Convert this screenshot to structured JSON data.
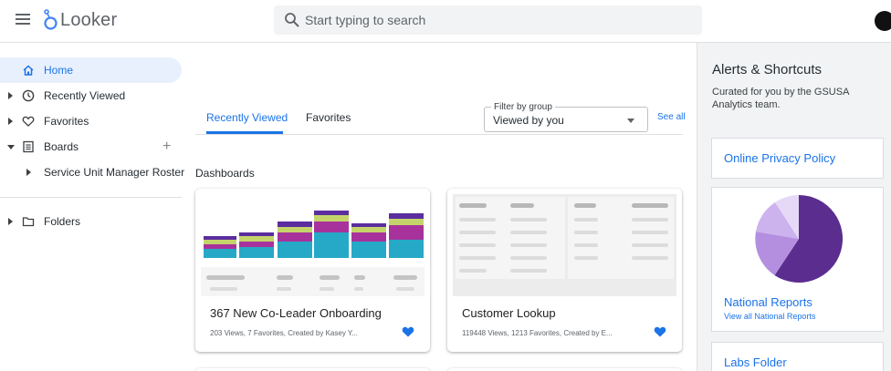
{
  "header": {
    "app_name": "Looker",
    "search_placeholder": "Start typing to search"
  },
  "sidebar": {
    "items": [
      {
        "label": "Home",
        "icon": "home-icon",
        "active": true
      },
      {
        "label": "Recently Viewed",
        "icon": "clock-icon"
      },
      {
        "label": "Favorites",
        "icon": "heart-outline-icon"
      },
      {
        "label": "Boards",
        "icon": "board-icon",
        "expanded": true
      },
      {
        "label": "Service Unit Manager Roster"
      },
      {
        "label": "Folders",
        "icon": "folder-icon"
      }
    ],
    "add_board_symbol": "+"
  },
  "main": {
    "tabs": [
      {
        "label": "Recently Viewed",
        "active": true
      },
      {
        "label": "Favorites"
      }
    ],
    "filter": {
      "label": "Filter by group",
      "value": "Viewed by you"
    },
    "see_all": "See all",
    "section_title": "Dashboards",
    "cards": [
      {
        "title": "367 New Co-Leader Onboarding",
        "meta": "203 Views, 7 Favorites, Created by Kasey Y...",
        "favorited": true
      },
      {
        "title": "Customer Lookup",
        "meta": "119448 Views, 1213 Favorites, Created by E...",
        "favorited": true
      }
    ]
  },
  "right_panel": {
    "title": "Alerts & Shortcuts",
    "subtitle": "Curated for you by the GSUSA Analytics team.",
    "cards": [
      {
        "title": "Online Privacy Policy"
      },
      {
        "title": "National Reports",
        "link": "View all National Reports"
      },
      {
        "title": "Labs Folder"
      }
    ]
  },
  "colors": {
    "accent": "#1a73e8",
    "heart": "#1a73e8",
    "bar_teal": "#26a9c7",
    "bar_magenta": "#a8329c",
    "bar_lime": "#c4d46b",
    "bar_purple": "#5b2d9e",
    "pie_dark": "#5b2d8f",
    "pie_mid": "#b48fe0",
    "pie_light": "#d6c1f0"
  }
}
